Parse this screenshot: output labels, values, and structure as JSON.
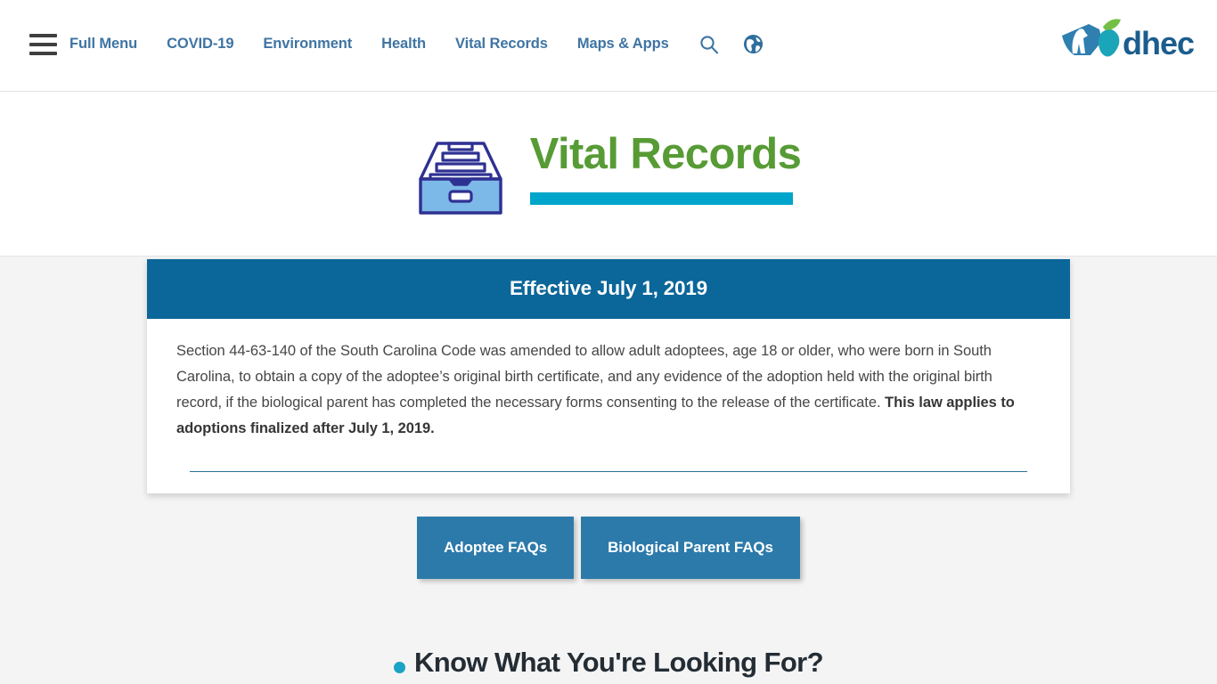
{
  "nav": {
    "menu_icon": "hamburger-icon",
    "links": [
      {
        "label": "Full Menu"
      },
      {
        "label": "COVID-19"
      },
      {
        "label": "Environment"
      },
      {
        "label": "Health"
      },
      {
        "label": "Vital Records"
      },
      {
        "label": "Maps & Apps"
      }
    ],
    "icons": [
      {
        "name": "search-icon"
      },
      {
        "name": "globe-icon"
      }
    ],
    "link_color": "#3f74a3"
  },
  "logo": {
    "wordmark": "dhec",
    "wordmark_color": "#1b5d8e",
    "mark_color": "#1aa5b8",
    "leaf_color": "#74bf44"
  },
  "page_header": {
    "icon": "file-drawer-icon",
    "title": "Vital Records",
    "title_color": "#579b35",
    "underline_color": "#00a5cb"
  },
  "card": {
    "header": "Effective July 1, 2019",
    "header_bg": "#0b6699",
    "paragraph": "Section 44-63-140 of the South Carolina Code was amended to allow adult adoptees, age 18 or older, who were born in South Carolina, to obtain a copy of the adoptee’s original birth certificate, and any evidence of the adoption held with the original birth record, if the biological parent has completed the necessary forms consenting to the release of the certificate. ",
    "paragraph_bold": "This law applies to adoptions finalized after July 1, 2019."
  },
  "buttons": [
    {
      "label": "Adoptee FAQs"
    },
    {
      "label": "Biological Parent FAQs"
    }
  ],
  "button_color": "#2c7aaa",
  "next_section": {
    "heading": "Know What You're Looking For?",
    "bullet_color": "#1aa3c4"
  }
}
